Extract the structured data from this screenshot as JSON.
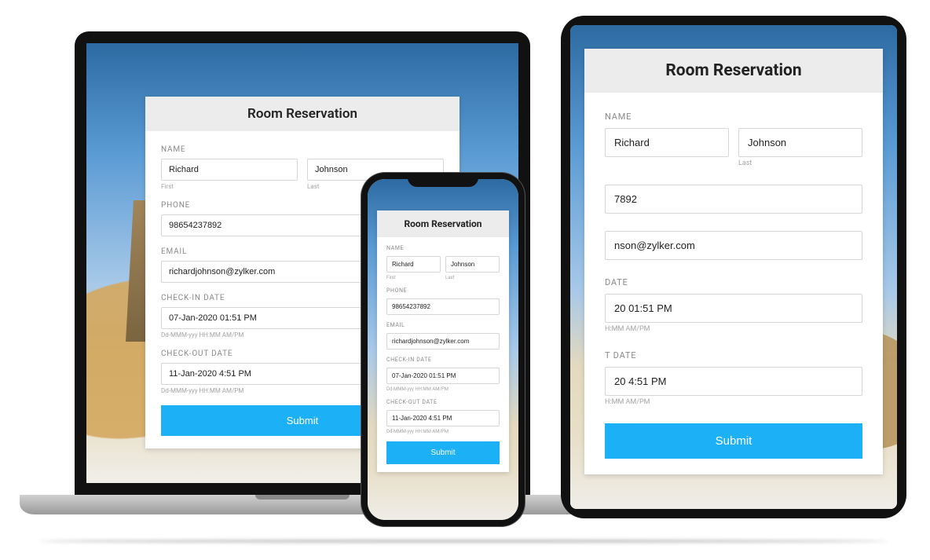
{
  "form": {
    "title": "Room Reservation",
    "name_label": "NAME",
    "first_help": "First",
    "last_help": "Last",
    "first_value": "Richard",
    "last_value": "Johnson",
    "phone_label": "PHONE",
    "phone_value": "98654237892",
    "email_label": "EMAIL",
    "email_value": "richardjohnson@zylker.com",
    "checkin_label": "CHECK-IN DATE",
    "checkin_value": "07-Jan-2020 01:51 PM",
    "checkout_label": "CHECK-OUT DATE",
    "checkout_value": "11-Jan-2020 4:51 PM",
    "date_help": "Dd-MMM-yyy HH:MM AM/PM",
    "submit_label": "Submit"
  },
  "tablet": {
    "phone_partial": "7892",
    "email_partial": "nson@zylker.com",
    "checkin_label_partial": "DATE",
    "checkin_partial": "20 01:51 PM",
    "checkout_label_partial": "T DATE",
    "checkout_partial": "20 4:51 PM",
    "date_help_partial": "H:MM AM/PM"
  },
  "colors": {
    "accent": "#1cb0f6",
    "header_bg": "#ececec"
  }
}
